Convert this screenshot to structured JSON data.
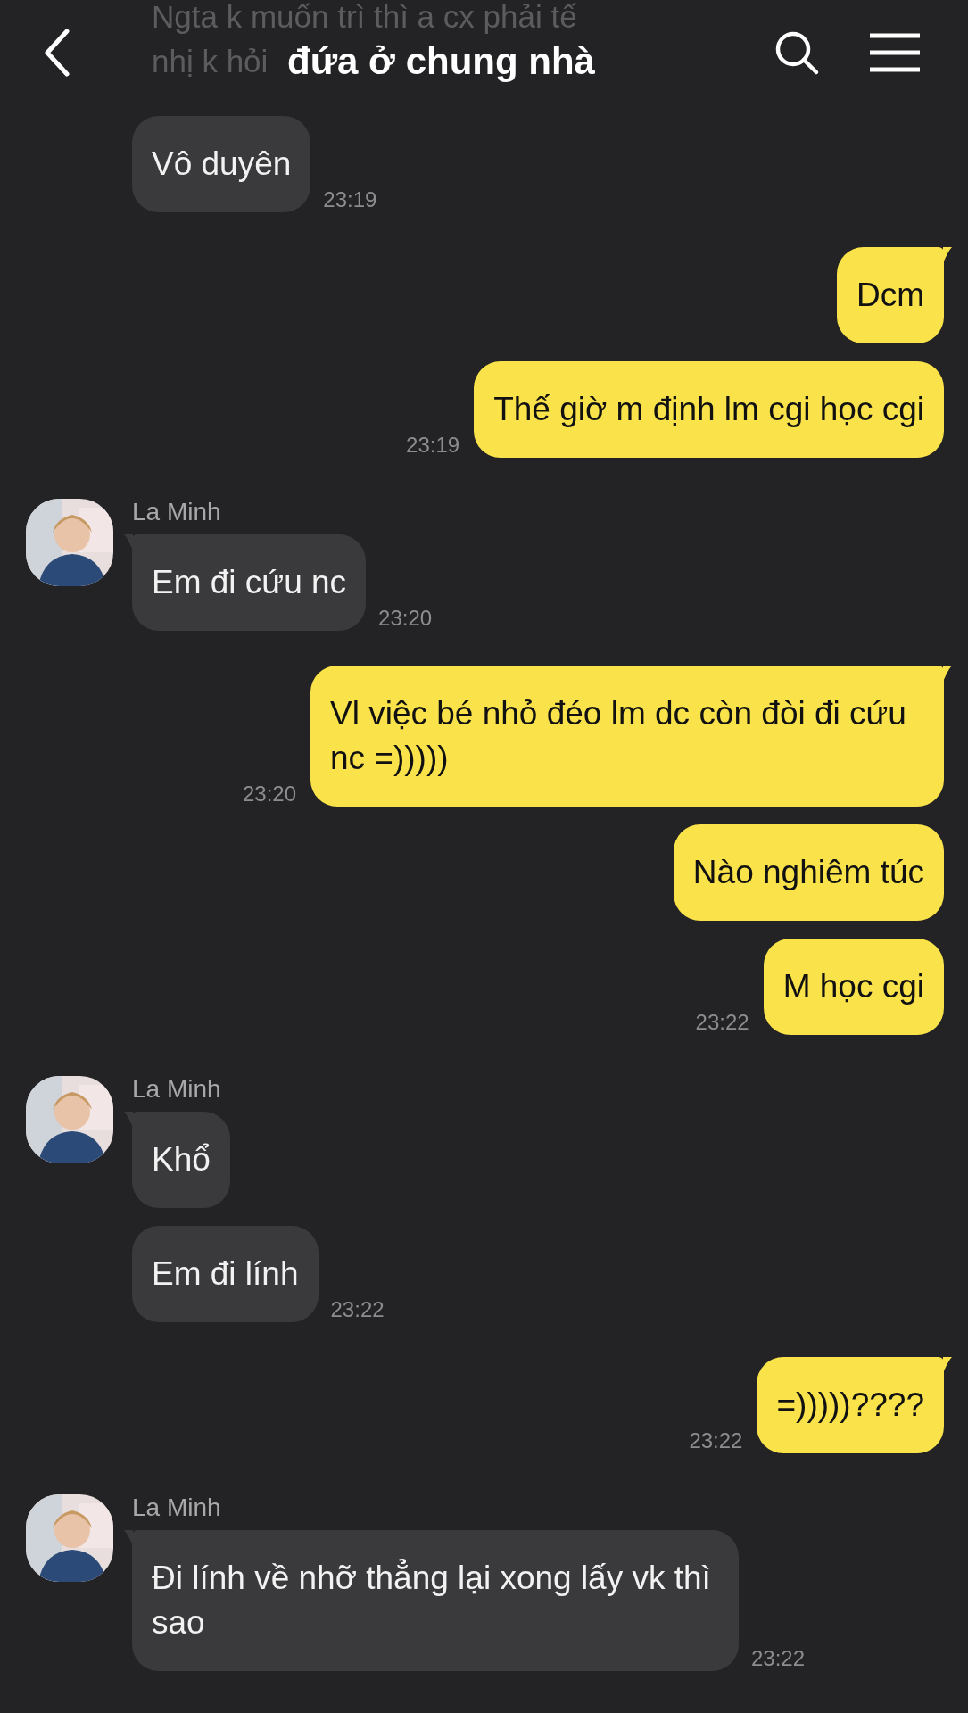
{
  "header": {
    "title": "đứa ở chung nhà",
    "behind_lines": [
      "Ngta k muốn trì thì a cx phải tế",
      "nhị k hỏi"
    ]
  },
  "messages": [
    {
      "kind": "incoming",
      "text": "Vô duyên",
      "time": "23:19",
      "group_start": false
    },
    {
      "kind": "outgoing",
      "text": "Dcm",
      "group_start": true
    },
    {
      "kind": "outgoing",
      "text": "Thế giờ m định lm cgi học cgi",
      "time": "23:19",
      "group_start": false
    },
    {
      "kind": "incoming",
      "sender": "La Minh",
      "text": "Em đi cứu nc",
      "time": "23:20",
      "group_start": true
    },
    {
      "kind": "outgoing",
      "text": "Vl việc bé nhỏ đéo lm dc còn đòi đi cứu nc =)))))",
      "time": "23:20",
      "group_start": true
    },
    {
      "kind": "outgoing",
      "text": "Nào nghiêm túc",
      "group_start": false
    },
    {
      "kind": "outgoing",
      "text": "M học cgi",
      "time": "23:22",
      "group_start": false
    },
    {
      "kind": "incoming",
      "sender": "La Minh",
      "text": "Khổ",
      "group_start": true
    },
    {
      "kind": "incoming",
      "text": "Em đi lính",
      "time": "23:22",
      "group_start": false
    },
    {
      "kind": "outgoing",
      "text": "=)))))????",
      "time": "23:22",
      "group_start": true
    },
    {
      "kind": "incoming",
      "sender": "La Minh",
      "text": "Đi lính về nhỡ thẳng lại xong lấy vk thì sao",
      "time": "23:22",
      "group_start": true
    }
  ]
}
